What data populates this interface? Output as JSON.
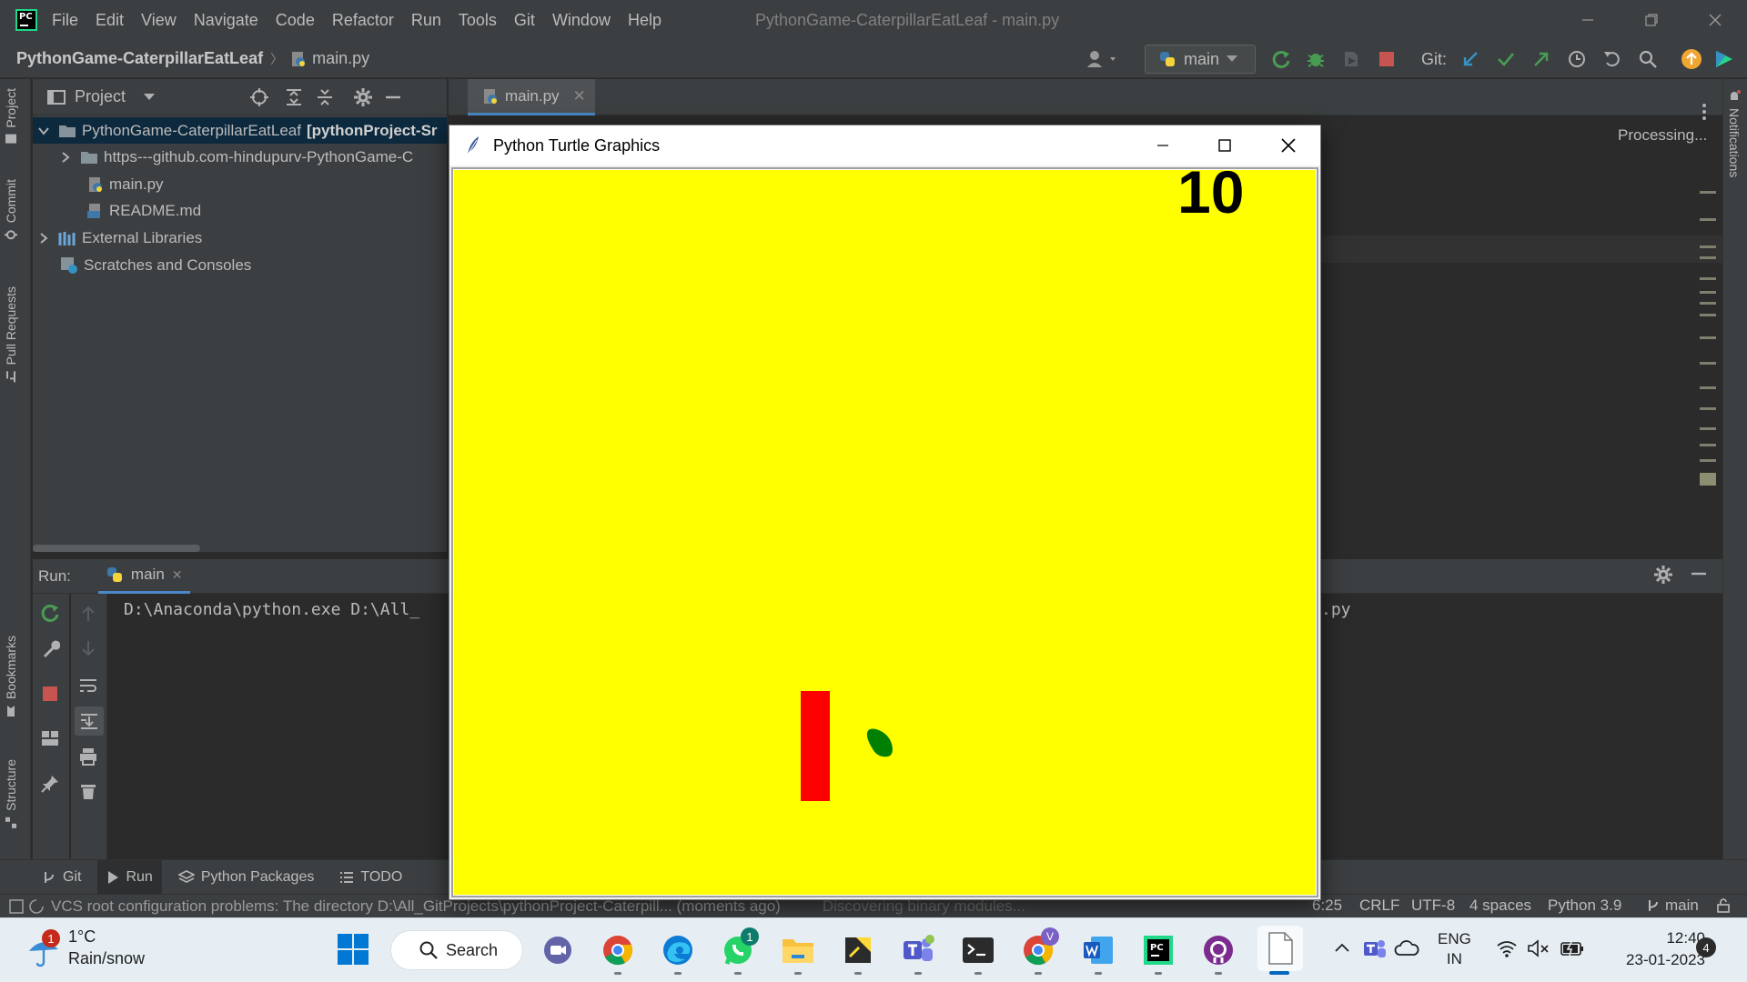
{
  "titlebar": {
    "menu": [
      "File",
      "Edit",
      "View",
      "Navigate",
      "Code",
      "Refactor",
      "Run",
      "Tools",
      "Git",
      "Window",
      "Help"
    ],
    "title": "PythonGame-CaterpillarEatLeaf - main.py"
  },
  "navbar": {
    "project": "PythonGame-CaterpillarEatLeaf",
    "file": "main.py",
    "run_config": "main",
    "git_label": "Git:"
  },
  "left_strip": {
    "tabs": [
      "Project",
      "Commit",
      "Pull Requests",
      "Bookmarks",
      "Structure"
    ]
  },
  "right_strip": {
    "tabs": [
      "Notifications"
    ]
  },
  "project_panel": {
    "title": "Project",
    "tree": [
      {
        "label": "PythonGame-CaterpillarEatLeaf",
        "suffix": "[pythonProject-Sr"
      },
      {
        "label": "https---github.com-hindupurv-PythonGame-C"
      },
      {
        "label": "main.py"
      },
      {
        "label": "README.md"
      },
      {
        "label": "External Libraries"
      },
      {
        "label": "Scratches and Consoles"
      }
    ]
  },
  "editor": {
    "tab": "main.py",
    "status": "Processing..."
  },
  "run_panel": {
    "label": "Run:",
    "tab": "main",
    "console_a": "D:\\Anaconda\\python.exe D:\\All_",
    "console_b": ".py"
  },
  "bottom_tabs": [
    "Git",
    "Run",
    "Python Packages",
    "TODO"
  ],
  "statusbar": {
    "message": "VCS root configuration problems: The directory D:\\All_GitProjects\\pythonProject-Caterpill... (moments ago)",
    "background_task": "Discovering binary modules...",
    "position": "6:25",
    "line_sep": "CRLF",
    "encoding": "UTF-8",
    "indent": "4 spaces",
    "interpreter": "Python 3.9",
    "branch": "main"
  },
  "turtle_window": {
    "title": "Python Turtle Graphics",
    "score": "10",
    "colors": {
      "background": "#ffff00",
      "caterpillar": "#ff0000",
      "leaf": "#008000"
    }
  },
  "taskbar": {
    "weather_temp": "1°C",
    "weather_desc": "Rain/snow",
    "weather_badge": "1",
    "search_label": "Search",
    "whatsapp_badge": "1",
    "chrome_profile_badge": "V",
    "lang_line1": "ENG",
    "lang_line2": "IN",
    "time": "12:40",
    "date": "23-01-2023",
    "notification_count": "4"
  }
}
